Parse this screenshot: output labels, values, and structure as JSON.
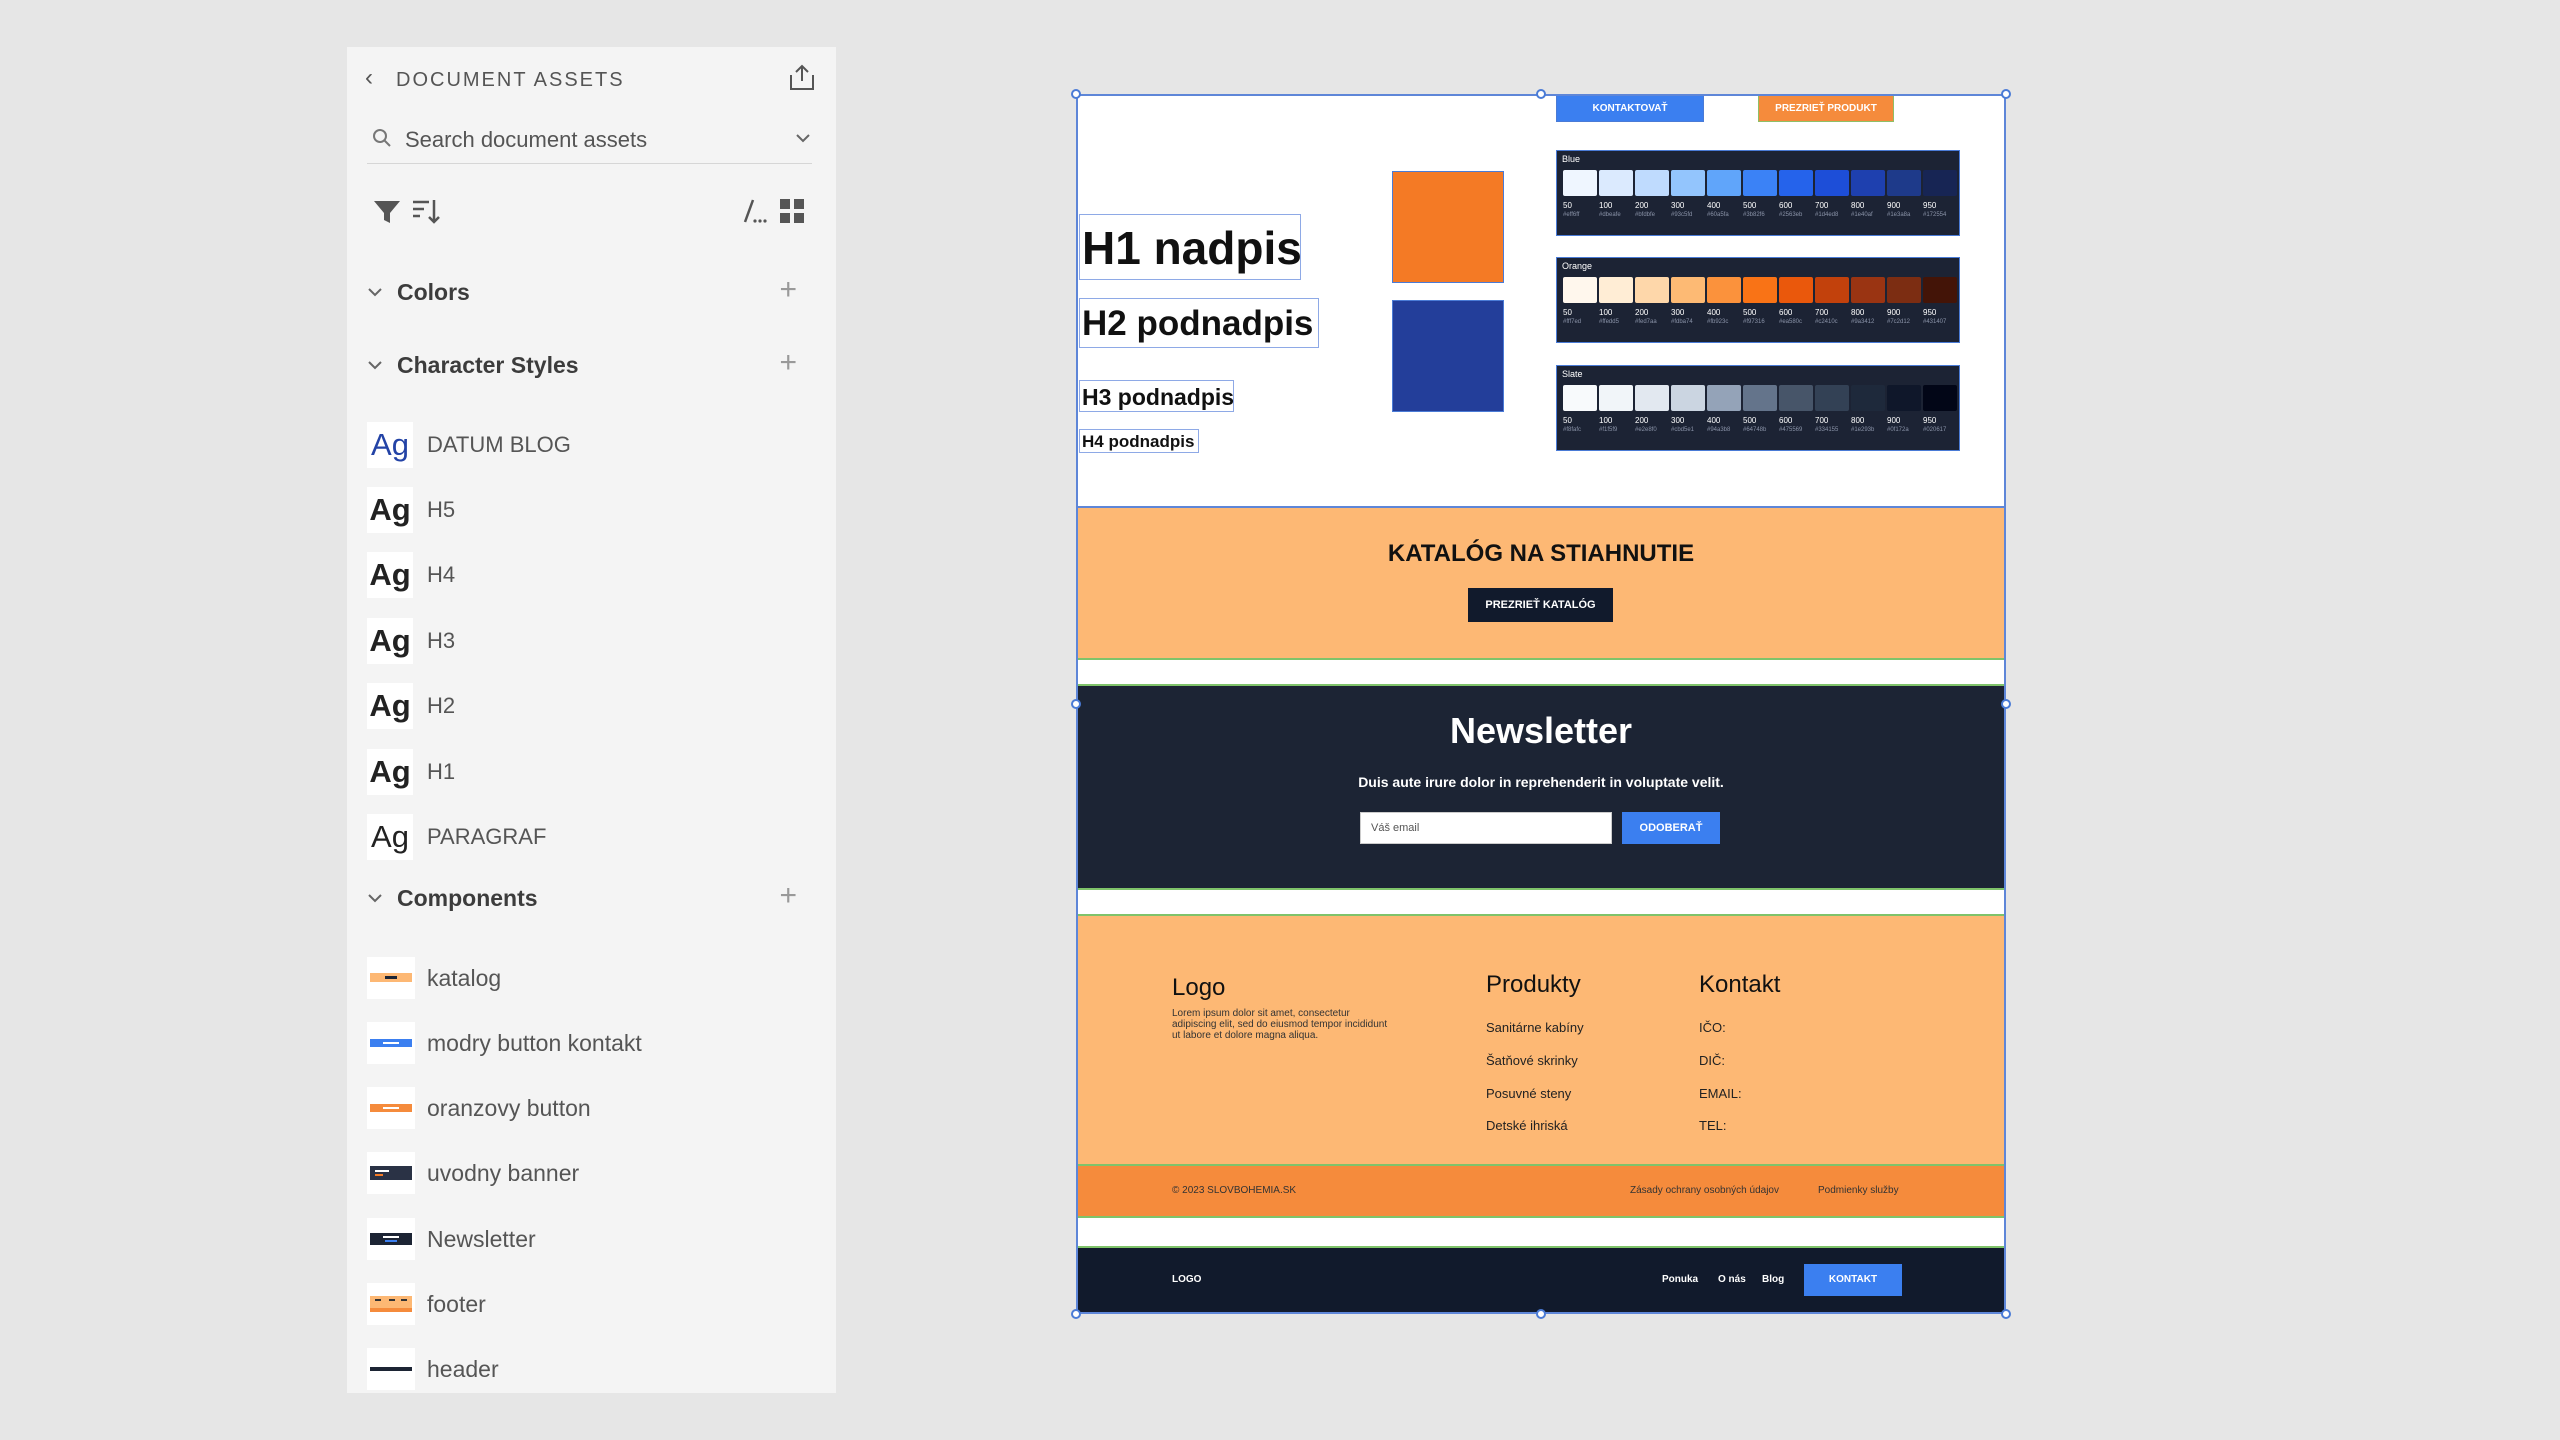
{
  "sidebar": {
    "title": "DOCUMENT ASSETS",
    "search_placeholder": "Search document assets",
    "colors_label": "Colors",
    "character_styles_label": "Character Styles",
    "character_styles": [
      {
        "ag": "Ag",
        "label": "DATUM BLOG"
      },
      {
        "ag": "Ag",
        "label": "H5"
      },
      {
        "ag": "Ag",
        "label": "H4"
      },
      {
        "ag": "Ag",
        "label": "H3"
      },
      {
        "ag": "Ag",
        "label": "H2"
      },
      {
        "ag": "Ag",
        "label": "H1"
      },
      {
        "ag": "Ag",
        "label": "PARAGRAF"
      }
    ],
    "components_label": "Components",
    "components": [
      {
        "label": "katalog"
      },
      {
        "label": "modry button kontakt"
      },
      {
        "label": "oranzovy button"
      },
      {
        "label": "uvodny banner"
      },
      {
        "label": "Newsletter"
      },
      {
        "label": "footer"
      },
      {
        "label": "header"
      }
    ],
    "icons": {
      "back": "chevron-left-icon",
      "share": "share-icon",
      "search": "search-icon",
      "dropdown": "chevron-down-icon",
      "filter": "filter-icon",
      "sort": "sort-icon",
      "list_view": "list-view-icon",
      "grid_view": "grid-view-icon",
      "add": "plus-icon"
    }
  },
  "board": {
    "btn_kontaktovat": "KONTAKTOVAŤ",
    "btn_prezriet_produkt": "PREZRIEŤ PRODUKT",
    "h1": "H1 nadpis",
    "h2": "H2 podnadpis",
    "h3": "H3 podnadpis",
    "h4": "H4 podnadpis",
    "palettes": [
      {
        "name": "Blue",
        "steps": [
          "50",
          "100",
          "200",
          "300",
          "400",
          "500",
          "600",
          "700",
          "800",
          "900",
          "950"
        ],
        "hex": [
          "#eff6ff",
          "#dbeafe",
          "#bfdbfe",
          "#93c5fd",
          "#60a5fa",
          "#3b82f6",
          "#2563eb",
          "#1d4ed8",
          "#1e40af",
          "#1e3a8a",
          "#172554"
        ]
      },
      {
        "name": "Orange",
        "steps": [
          "50",
          "100",
          "200",
          "300",
          "400",
          "500",
          "600",
          "700",
          "800",
          "900",
          "950"
        ],
        "hex": [
          "#fff7ed",
          "#ffedd5",
          "#fed7aa",
          "#fdba74",
          "#fb923c",
          "#f97316",
          "#ea580c",
          "#c2410c",
          "#9a3412",
          "#7c2d12",
          "#431407"
        ]
      },
      {
        "name": "Slate",
        "steps": [
          "50",
          "100",
          "200",
          "300",
          "400",
          "500",
          "600",
          "700",
          "800",
          "900",
          "950"
        ],
        "hex": [
          "#f8fafc",
          "#f1f5f9",
          "#e2e8f0",
          "#cbd5e1",
          "#94a3b8",
          "#64748b",
          "#475569",
          "#334155",
          "#1e293b",
          "#0f172a",
          "#020617"
        ]
      }
    ],
    "katalog_title": "KATALÓG NA STIAHNUTIE",
    "katalog_button": "PREZRIEŤ KATALÓG",
    "newsletter_title": "Newsletter",
    "newsletter_text": "Duis aute irure dolor in reprehenderit in voluptate velit.",
    "newsletter_placeholder": "Váš email",
    "newsletter_button": "ODOBERAŤ",
    "footer": {
      "logo_head": "Logo",
      "lorem": "Lorem ipsum dolor sit amet, consectetur adipiscing elit, sed do eiusmod tempor incididunt ut labore et dolore magna aliqua.",
      "produkty_head": "Produkty",
      "produkty": [
        "Sanitárne kabíny",
        "Šatňové skrinky",
        "Posuvné steny",
        "Detské ihriská"
      ],
      "kontakt_head": "Kontakt",
      "kontakt": [
        "IČO:",
        "DIČ:",
        "EMAIL:",
        "TEL:"
      ],
      "copyright": "© 2023 SLOVBOHEMIA.SK",
      "privacy": "Zásady ochrany osobných údajov",
      "terms": "Podmienky služby"
    },
    "header": {
      "logo": "LOGO",
      "nav": [
        "Ponuka",
        "O nás",
        "Blog"
      ],
      "button": "KONTAKT"
    }
  },
  "colors": {
    "orange": "#f47a25",
    "blue": "#233e9a",
    "light_orange": "#fdb874",
    "dark_navy": "#1c2434",
    "accent_blue": "#3b7ff0"
  }
}
